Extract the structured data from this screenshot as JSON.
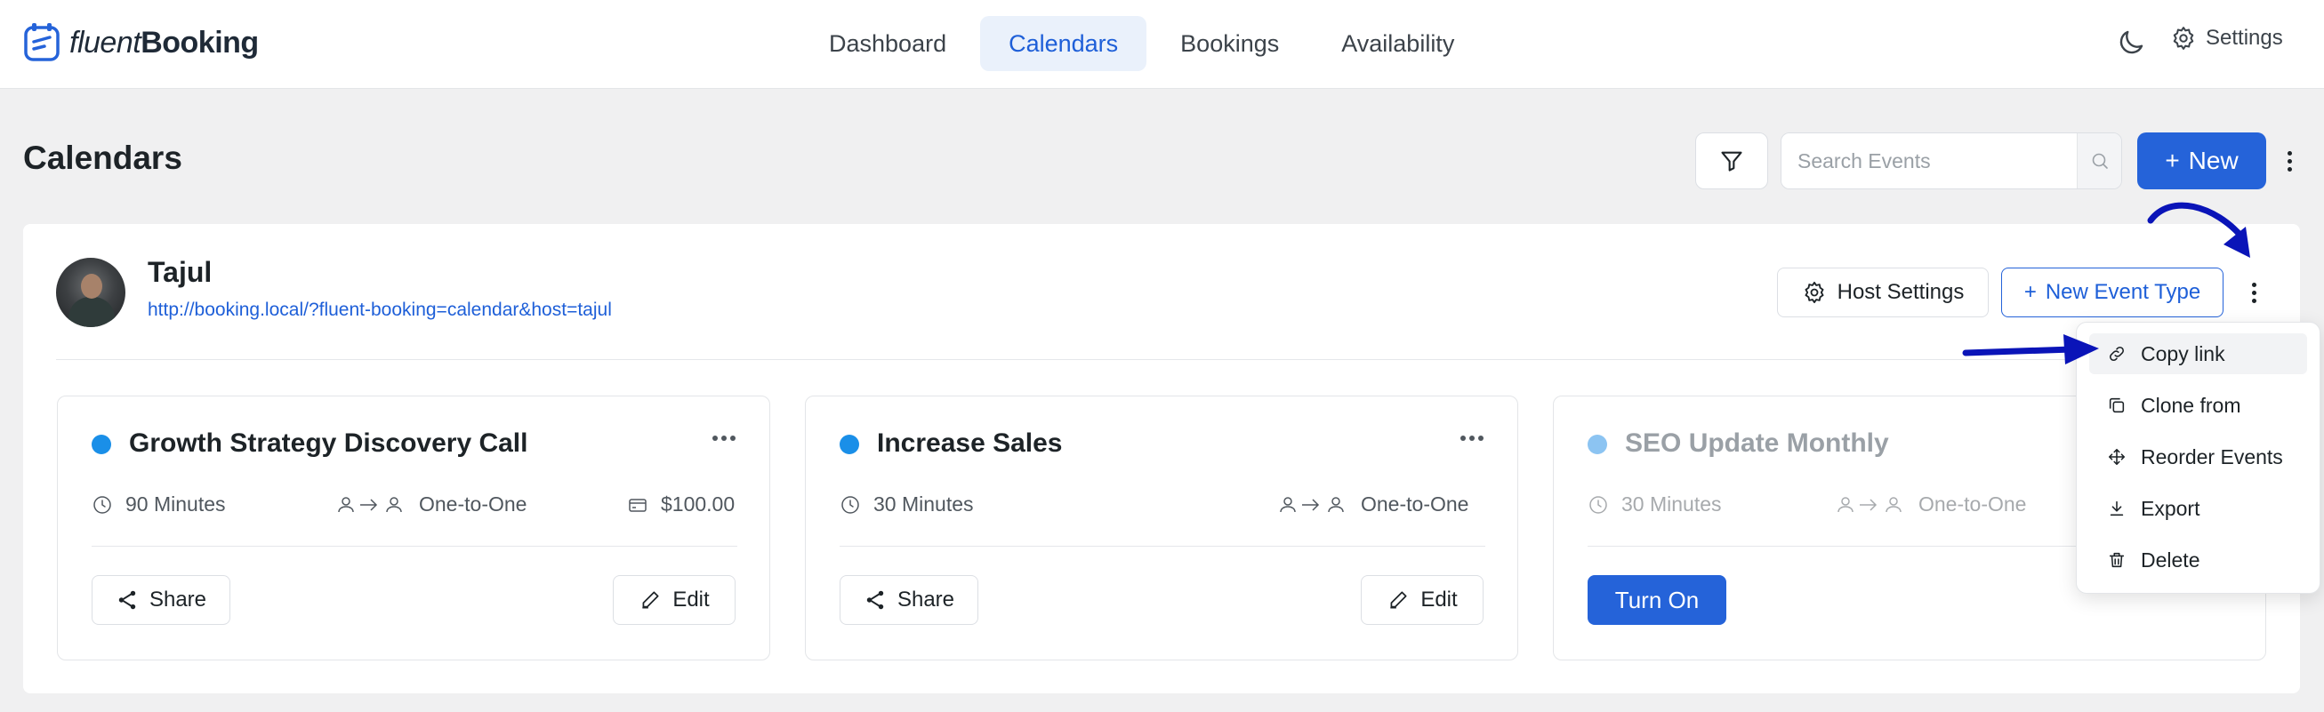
{
  "app": {
    "brand_light": "fluent",
    "brand_bold": "Booking"
  },
  "nav": {
    "items": [
      {
        "label": "Dashboard",
        "active": false
      },
      {
        "label": "Calendars",
        "active": true
      },
      {
        "label": "Bookings",
        "active": false
      },
      {
        "label": "Availability",
        "active": false
      }
    ]
  },
  "header_right": {
    "theme_icon": "moon-icon",
    "settings_label": "Settings"
  },
  "page": {
    "title": "Calendars",
    "search_placeholder": "Search Events",
    "new_button_label": "New",
    "new_button_prefix": "+"
  },
  "host": {
    "name": "Tajul",
    "url": "http://booking.local/?fluent-booking=calendar&host=tajul",
    "host_settings_label": "Host Settings",
    "new_event_type_label": "New Event Type",
    "new_event_type_prefix": "+"
  },
  "events": [
    {
      "title": "Growth Strategy Discovery Call",
      "duration": "90 Minutes",
      "type": "One-to-One",
      "price": "$100.00",
      "enabled": true,
      "share_label": "Share",
      "edit_label": "Edit"
    },
    {
      "title": "Increase Sales",
      "duration": "30 Minutes",
      "type": "One-to-One",
      "enabled": true,
      "share_label": "Share",
      "edit_label": "Edit"
    },
    {
      "title": "SEO Update Monthly",
      "duration": "30 Minutes",
      "type": "One-to-One",
      "enabled": false,
      "turn_on_label": "Turn On"
    }
  ],
  "dropdown": {
    "items": [
      {
        "label": "Copy link",
        "icon": "link-icon",
        "highlighted": true
      },
      {
        "label": "Clone from",
        "icon": "clone-icon"
      },
      {
        "label": "Reorder Events",
        "icon": "move-icon"
      },
      {
        "label": "Export",
        "icon": "download-icon"
      },
      {
        "label": "Delete",
        "icon": "trash-icon"
      }
    ]
  },
  "colors": {
    "primary": "#2563d9",
    "active_dot": "#1a8fe8",
    "inactive_dot": "#8cc4f2",
    "annotation_arrow": "#0a14b8"
  }
}
